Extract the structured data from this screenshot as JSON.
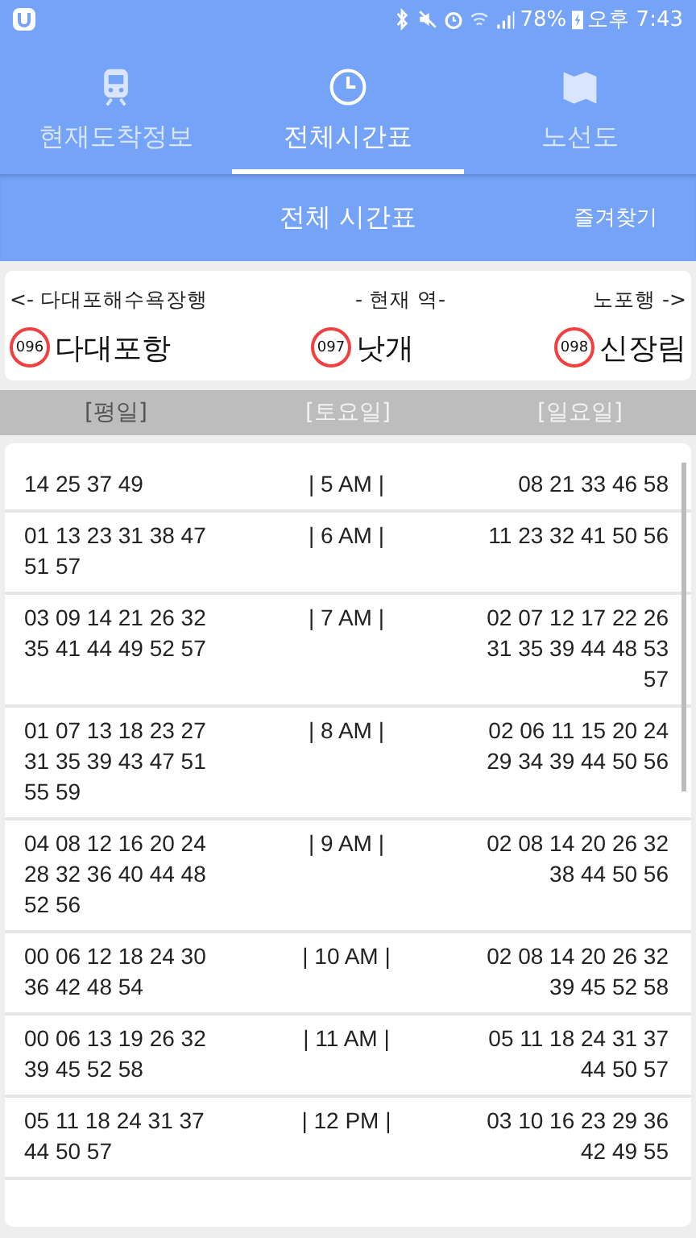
{
  "status_bar": {
    "battery": "78%",
    "time": "오후 7:43"
  },
  "tabs": [
    {
      "label": "현재도착정보",
      "kind": "train",
      "selected": false
    },
    {
      "label": "전체시간표",
      "kind": "clock",
      "selected": true
    },
    {
      "label": "노선도",
      "kind": "map",
      "selected": false
    }
  ],
  "toolbar": {
    "title": "전체 시간표",
    "action": "즐겨찾기"
  },
  "stations": {
    "prev_direction": "<- 다대포해수욕장행",
    "current_label": "- 현재 역-",
    "next_direction": "노포행 ->",
    "items": [
      {
        "code": "096",
        "name": "다대포항"
      },
      {
        "code": "097",
        "name": "낫개"
      },
      {
        "code": "098",
        "name": "신장림"
      }
    ]
  },
  "day_tabs": [
    {
      "label": "[평일]",
      "selected": true
    },
    {
      "label": "[토요일]",
      "selected": false
    },
    {
      "label": "[일요일]",
      "selected": false
    }
  ],
  "timetable": [
    {
      "left": "14 25 37 49",
      "hour": "| 5 AM |",
      "right": "08 21 33 46 58"
    },
    {
      "left": "01 13 23 31 38 47\n51 57",
      "hour": "| 6 AM |",
      "right": "11 23 32 41 50 56"
    },
    {
      "left": "03 09 14 21 26 32\n35 41 44 49 52 57",
      "hour": "| 7 AM |",
      "right": "02 07 12 17 22 26\n31 35 39 44 48 53\n57"
    },
    {
      "left": "01 07 13 18 23 27\n31 35 39 43 47 51\n55 59",
      "hour": "| 8 AM |",
      "right": "02 06 11 15 20 24\n29 34 39 44 50 56"
    },
    {
      "left": "04 08 12 16 20 24\n28 32 36 40 44 48\n52 56",
      "hour": "| 9 AM |",
      "right": "02 08 14 20 26 32\n38 44 50 56"
    },
    {
      "left": "00 06 12 18 24 30\n36 42 48 54",
      "hour": "| 10 AM |",
      "right": "02 08 14 20 26 32\n39 45 52 58"
    },
    {
      "left": "00 06 13 19 26 32\n39 45 52 58",
      "hour": "| 11 AM |",
      "right": "05 11 18 24 31 37\n44 50 57"
    },
    {
      "left": "05 11 18 24 31 37\n44 50 57",
      "hour": "| 12 PM |",
      "right": "03 10 16 23 29 36\n42 49 55"
    }
  ]
}
